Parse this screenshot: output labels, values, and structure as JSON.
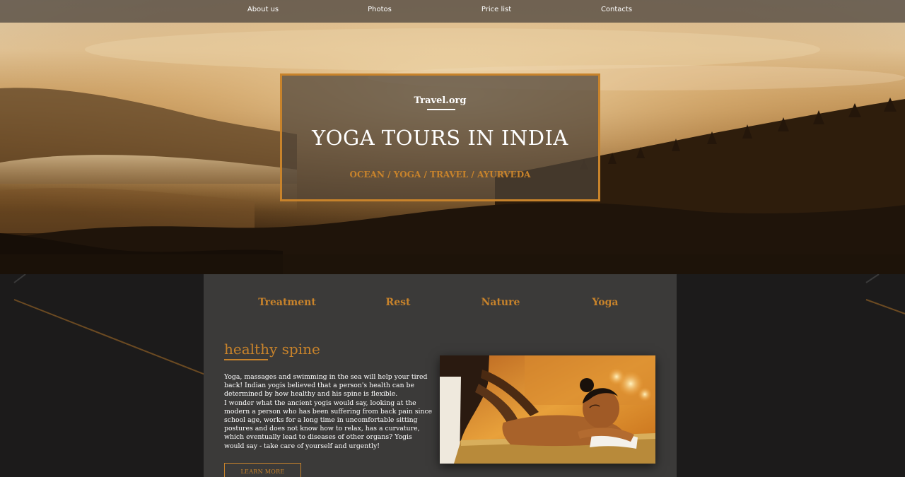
{
  "nav": {
    "items": [
      "About us",
      "Photos",
      "Price list",
      "Contacts"
    ]
  },
  "hero": {
    "brand": "Travel.org",
    "title": "YOGA TOURS IN INDIA",
    "tags": "OCEAN / YOGA / TRAVEL / AYURVEDA"
  },
  "tabs": [
    "Treatment",
    "Rest",
    "Nature",
    "Yoga"
  ],
  "article": {
    "heading": "healthy spine",
    "paragraphs": [
      "Yoga, massages and swimming in the sea will help your tired back! Indian yogis believed that a person's health can be determined by how healthy and his spine is flexible.",
      "I wonder what the ancient yogis would say, looking at the modern a person who has been suffering from back pain since school age, works for a long time in uncomfortable sitting postures and does not know how to relax, has a curvature, which eventually lead to diseases of other organs? Yogis would say - take care of yourself and urgently!"
    ],
    "button_label": "LEARN MORE"
  },
  "colors": {
    "accent": "#c8832b",
    "panel": "#3b3a39",
    "page_background": "#1c1b1b",
    "nav_background": "#46403a",
    "text": "#ffffff"
  }
}
